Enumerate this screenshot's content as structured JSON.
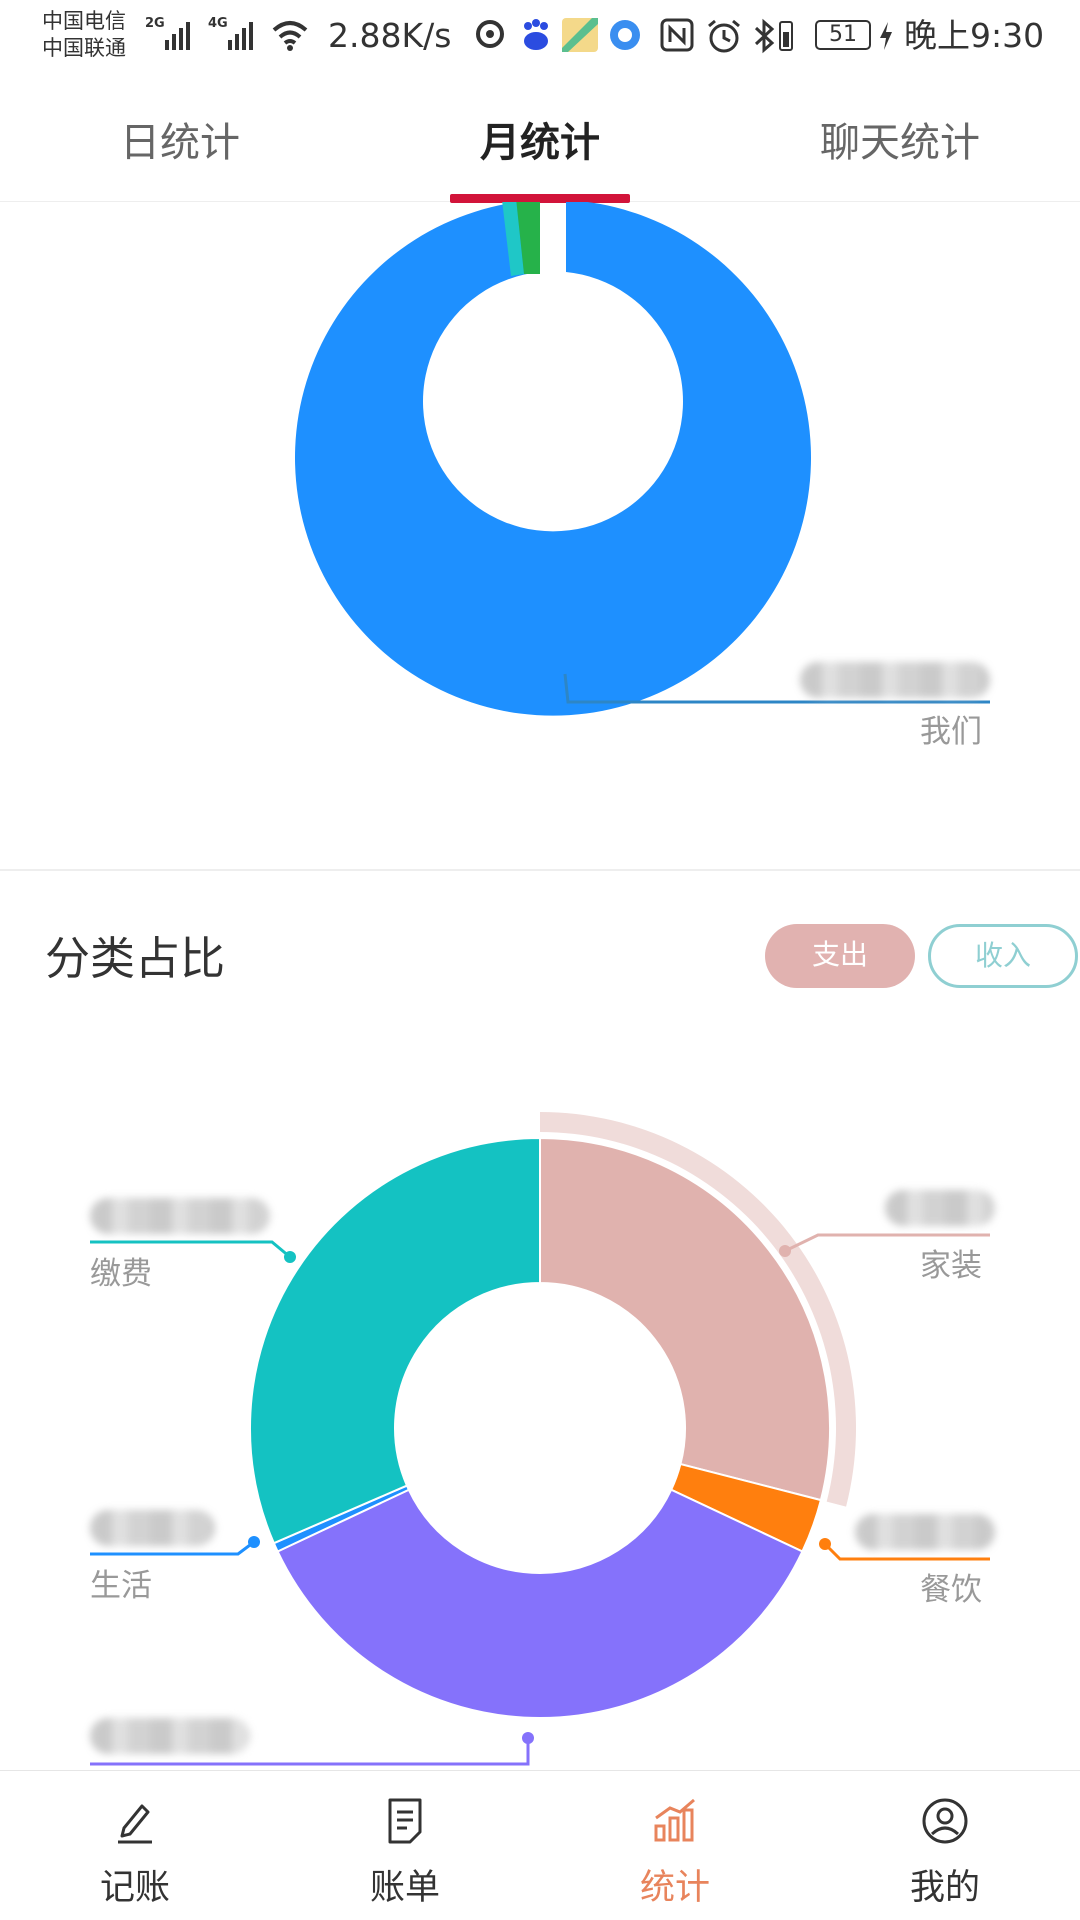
{
  "status_bar": {
    "carrier_1": "中国电信",
    "carrier_2": "中国联通",
    "net_1": "2G",
    "net_2": "4G",
    "speed": "2.88K/s",
    "battery": "51",
    "time": "晚上9:30"
  },
  "tabs": [
    {
      "label": "日统计",
      "active": false
    },
    {
      "label": "月统计",
      "active": true
    },
    {
      "label": "聊天统计",
      "active": false
    }
  ],
  "member_chart": {
    "slice_labels": [
      "我们"
    ],
    "colors": {
      "main": "#1e90ff",
      "small_1": "#1fc7c7",
      "small_2": "#26b24a"
    }
  },
  "category": {
    "title": "分类占比",
    "buttons": {
      "expense": "支出",
      "income": "收入"
    },
    "active_button": "expense"
  },
  "chart_data": {
    "type": "pie",
    "title": "",
    "slices": [
      {
        "label": "家装",
        "value": 29,
        "color": "#e0b2ae"
      },
      {
        "label": "餐饮",
        "value": 3,
        "color": "#ff7f0e"
      },
      {
        "label": "",
        "value": 36,
        "color": "#8572fb"
      },
      {
        "label": "生活",
        "value": 0.5,
        "color": "#1e90ff"
      },
      {
        "label": "缴费",
        "value": 31.5,
        "color": "#14c2c2"
      }
    ],
    "highlighted": "家装"
  },
  "bottom_nav": [
    {
      "label": "记账",
      "icon": "pencil-icon",
      "active": false
    },
    {
      "label": "账单",
      "icon": "bill-icon",
      "active": false
    },
    {
      "label": "统计",
      "icon": "bar-chart-icon",
      "active": true
    },
    {
      "label": "我的",
      "icon": "user-icon",
      "active": false
    }
  ]
}
